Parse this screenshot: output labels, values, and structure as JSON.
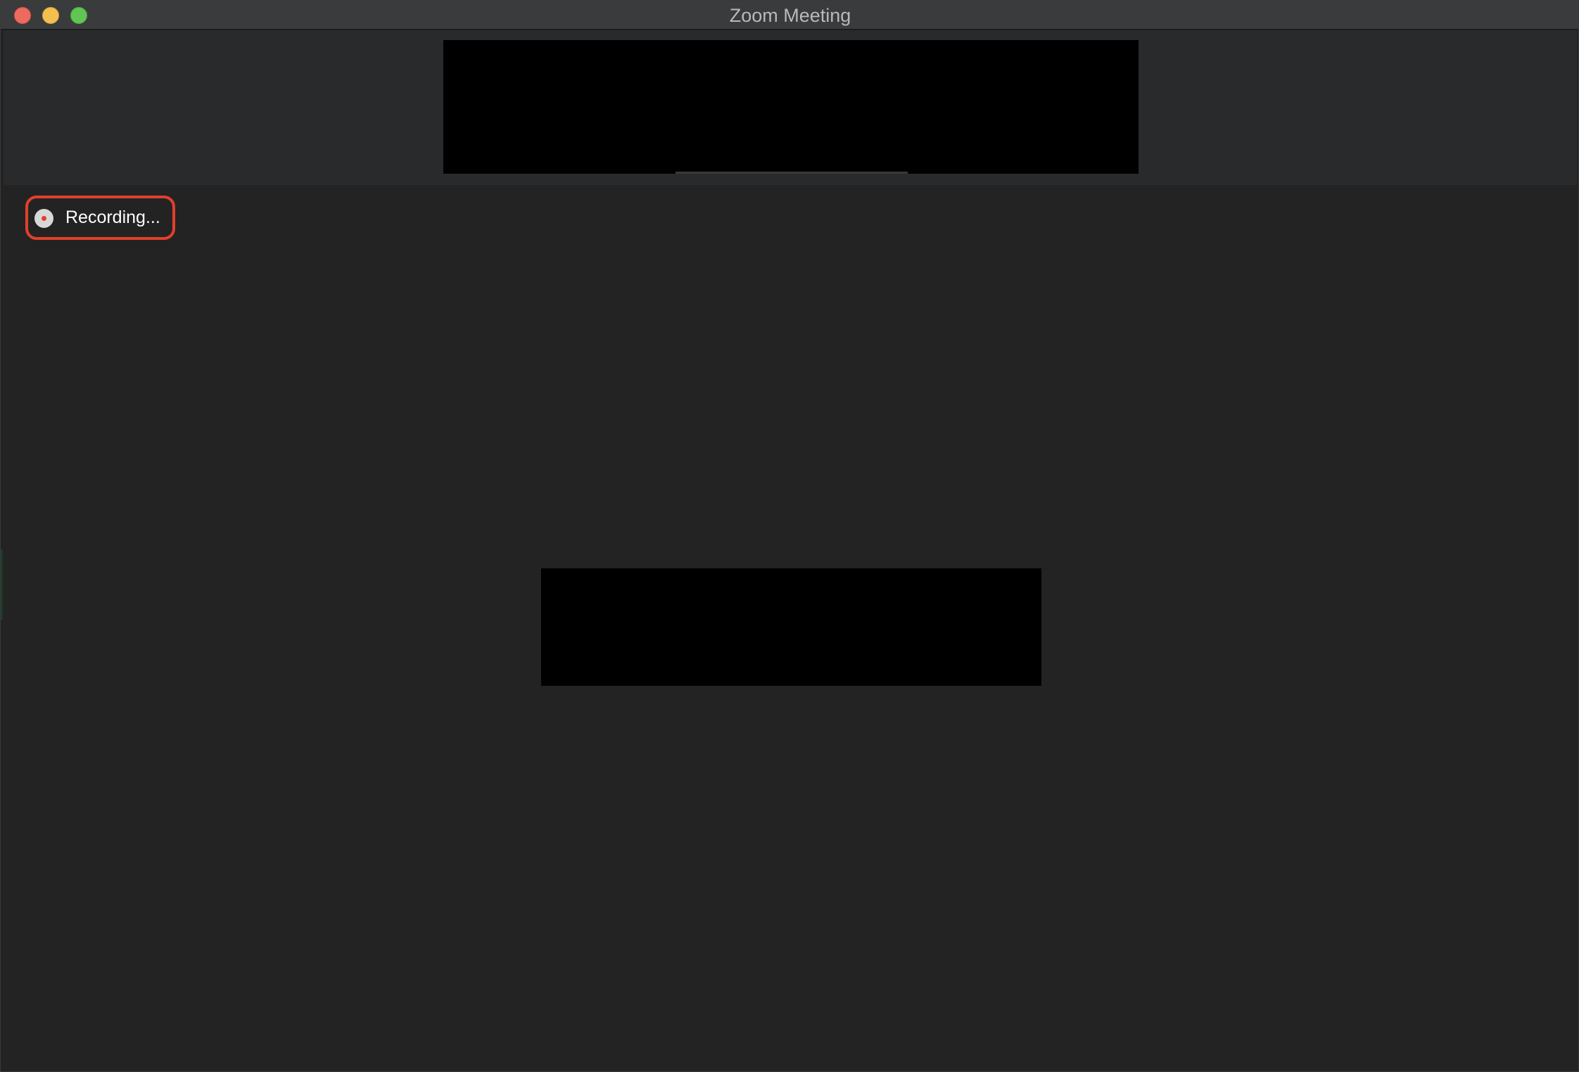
{
  "window": {
    "title": "Zoom Meeting"
  },
  "recording": {
    "label": "Recording...",
    "indicator_color": "#e0402d"
  },
  "icons": {
    "close": "close-window-icon",
    "minimize": "minimize-window-icon",
    "zoom": "zoom-window-icon",
    "recording": "record-icon"
  }
}
